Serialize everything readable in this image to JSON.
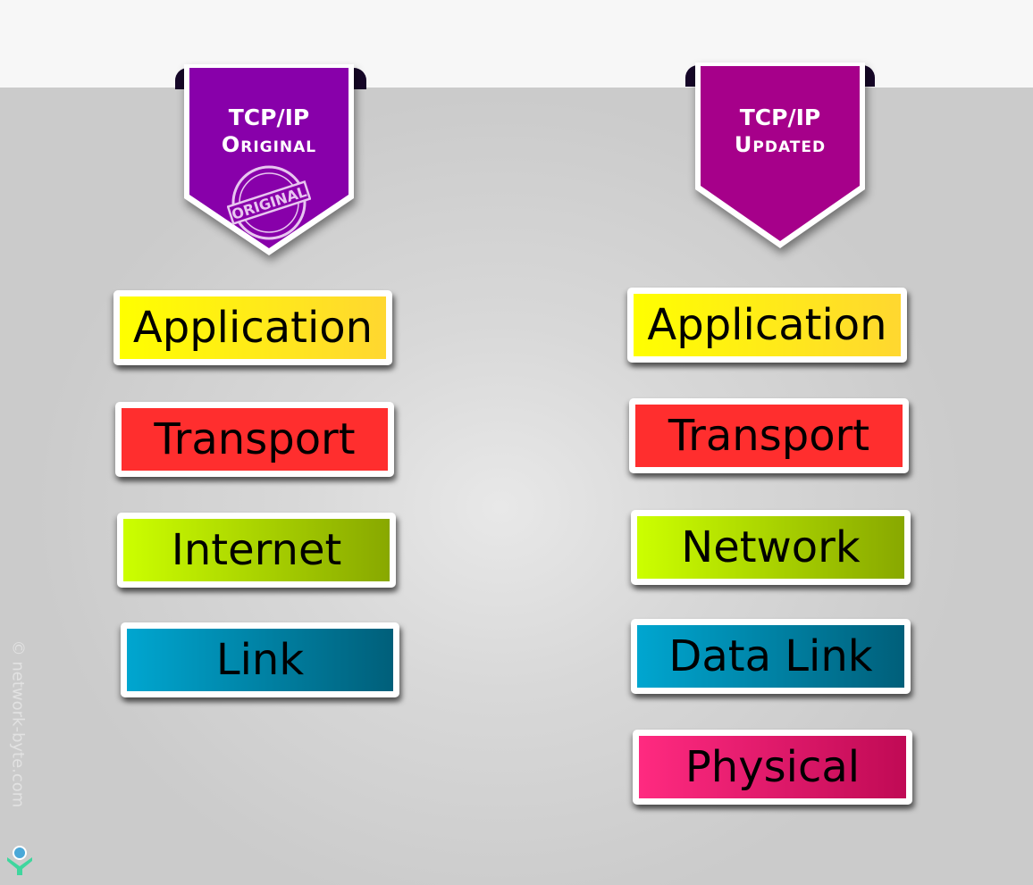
{
  "columns": [
    {
      "id": "original",
      "banner": {
        "line1": "TCP/IP",
        "line2": "Original",
        "color": "#8800aa",
        "stamp_text": "ORIGINAL"
      },
      "layers": [
        {
          "label": "Application",
          "gradient": [
            "#ffff00",
            "#ffd730"
          ]
        },
        {
          "label": "Transport",
          "gradient": [
            "#ff2e2e",
            "#ff2e2e"
          ]
        },
        {
          "label": "Internet",
          "gradient": [
            "#ccff00",
            "#88a800"
          ]
        },
        {
          "label": "Link",
          "gradient": [
            "#00a6d0",
            "#005f7a"
          ]
        }
      ]
    },
    {
      "id": "updated",
      "banner": {
        "line1": "TCP/IP",
        "line2": "Updated",
        "color": "#a6008a"
      },
      "layers": [
        {
          "label": "Application",
          "gradient": [
            "#ffff00",
            "#ffd730"
          ]
        },
        {
          "label": "Transport",
          "gradient": [
            "#ff2e2e",
            "#ff2e2e"
          ]
        },
        {
          "label": "Network",
          "gradient": [
            "#ccff00",
            "#88a800"
          ]
        },
        {
          "label": "Data Link",
          "gradient": [
            "#00a6d0",
            "#005f7a"
          ]
        },
        {
          "label": "Physical",
          "gradient": [
            "#ff2a80",
            "#c00a55"
          ]
        }
      ]
    }
  ],
  "watermark": "© network-byte.com"
}
